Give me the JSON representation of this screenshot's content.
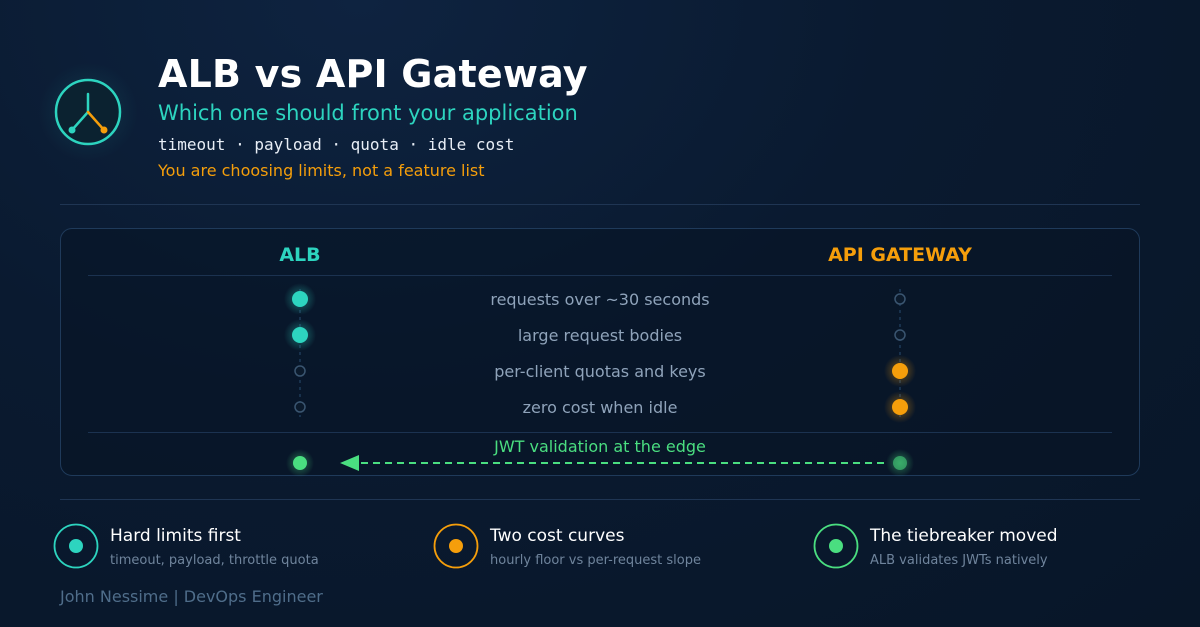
{
  "header": {
    "title": "ALB vs API Gateway",
    "subtitle": "Which one should front your application",
    "tags": "timeout · payload · quota · idle cost",
    "note": "You are choosing limits, not a feature list",
    "logo_icon": "fork-split-icon"
  },
  "comparison": {
    "left_heading": "ALB",
    "right_heading": "API GATEWAY",
    "rows": [
      {
        "label": "requests over ~30 seconds",
        "alb": true,
        "api": false
      },
      {
        "label": "large request bodies",
        "alb": true,
        "api": false
      },
      {
        "label": "per-client quotas and keys",
        "alb": false,
        "api": true
      },
      {
        "label": "zero cost when idle",
        "alb": false,
        "api": true
      }
    ],
    "shift": {
      "label": "JWT validation at the edge",
      "direction": "from-api-gateway-to-alb"
    }
  },
  "takeaways": [
    {
      "title": "Hard limits first",
      "subtitle": "timeout, payload, throttle quota",
      "color": "#2dd4bf"
    },
    {
      "title": "Two cost curves",
      "subtitle": "hourly floor vs per-request slope",
      "color": "#f59e0b"
    },
    {
      "title": "The tiebreaker moved",
      "subtitle": "ALB validates JWTs natively",
      "color": "#4ade80"
    }
  ],
  "author": "John Nessime | DevOps Engineer",
  "colors": {
    "alb": "#2dd4bf",
    "api": "#f59e0b",
    "jwt": "#4ade80",
    "muted": "#8fa3ba"
  }
}
